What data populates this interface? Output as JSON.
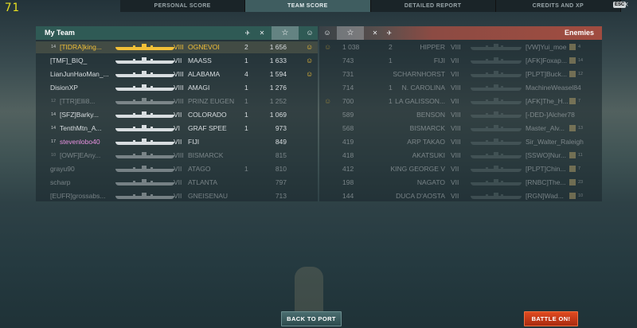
{
  "fps": "71",
  "nav": {
    "tabs": [
      "PERSONAL SCORE",
      "TEAM SCORE",
      "DETAILED REPORT",
      "CREDITS AND XP"
    ],
    "active_index": 1,
    "esc_label": "ESC",
    "close_glyph": "×"
  },
  "my_team": {
    "title": "My Team",
    "header_icons": [
      "plane-icon",
      "crossed-swords-icon",
      "star-icon",
      "achievement-icon"
    ],
    "rows": [
      {
        "level": "14",
        "player": "[TIDRA]king...",
        "tier": "VIII",
        "ship": "OGNEVOI",
        "kills": "2",
        "score": "1 656",
        "ribbon": "☺",
        "highlight": true,
        "player_color": "#f2c038",
        "ship_color": "#f2c038",
        "sil_color": "#f2c038",
        "dead": false
      },
      {
        "level": "",
        "player": "[TMF]_BIQ_",
        "tier": "VII",
        "ship": "MAASS",
        "kills": "1",
        "score": "1 633",
        "ribbon": "☺",
        "highlight": false,
        "player_color": "#d8dde0",
        "ship_color": "#d8dde0",
        "sil_color": "#d8dde0",
        "dead": false
      },
      {
        "level": "",
        "player": "LianJunHaoMan_...",
        "tier": "VIII",
        "ship": "ALABAMA",
        "kills": "4",
        "score": "1 594",
        "ribbon": "☺",
        "highlight": false,
        "player_color": "#d8dde0",
        "ship_color": "#d8dde0",
        "sil_color": "#d8dde0",
        "dead": false
      },
      {
        "level": "",
        "player": "DisionXP",
        "tier": "VIII",
        "ship": "AMAGI",
        "kills": "1",
        "score": "1 276",
        "ribbon": "",
        "highlight": false,
        "player_color": "#d8dde0",
        "ship_color": "#d8dde0",
        "sil_color": "#d8dde0",
        "dead": false
      },
      {
        "level": "12",
        "player": "[TTR]Elli8...",
        "tier": "VIII",
        "ship": "PRINZ EUGEN",
        "kills": "1",
        "score": "1 252",
        "ribbon": "",
        "highlight": false,
        "player_color": "#d8dde0",
        "ship_color": "#d8dde0",
        "sil_color": "#d8dde0",
        "dead": true,
        "rank": "▮"
      },
      {
        "level": "14",
        "player": "[SFZ]Barky...",
        "tier": "VII",
        "ship": "COLORADO",
        "kills": "1",
        "score": "1 069",
        "ribbon": "",
        "highlight": false,
        "player_color": "#d8dde0",
        "ship_color": "#d8dde0",
        "sil_color": "#d8dde0",
        "dead": false
      },
      {
        "level": "14",
        "player": "TenthMtn_A...",
        "tier": "VI",
        "ship": "GRAF SPEE",
        "kills": "1",
        "score": "973",
        "ribbon": "",
        "highlight": false,
        "player_color": "#d8dde0",
        "ship_color": "#d8dde0",
        "sil_color": "#d8dde0",
        "dead": false
      },
      {
        "level": "17",
        "player": "stevenlobo40",
        "tier": "VII",
        "ship": "FIJI",
        "kills": "",
        "score": "849",
        "ribbon": "",
        "highlight": false,
        "player_color": "#e890e0",
        "ship_color": "#d8dde0",
        "sil_color": "#d8dde0",
        "dead": false
      },
      {
        "level": "10",
        "player": "[OWF]EAny...",
        "tier": "VIII",
        "ship": "BISMARCK",
        "kills": "",
        "score": "815",
        "ribbon": "",
        "highlight": false,
        "player_color": "#d8dde0",
        "ship_color": "#d8dde0",
        "sil_color": "#d8dde0",
        "dead": true
      },
      {
        "level": "",
        "player": "grayu90",
        "tier": "VII",
        "ship": "ATAGO",
        "kills": "1",
        "score": "810",
        "ribbon": "",
        "highlight": false,
        "player_color": "#d8dde0",
        "ship_color": "#d8dde0",
        "sil_color": "#d8dde0",
        "dead": true,
        "rank": "▮"
      },
      {
        "level": "",
        "player": "scharp",
        "tier": "VII",
        "ship": "ATLANTA",
        "kills": "",
        "score": "797",
        "ribbon": "",
        "highlight": false,
        "player_color": "#d8dde0",
        "ship_color": "#d8dde0",
        "sil_color": "#d8dde0",
        "dead": true
      },
      {
        "level": "",
        "player": "[EUFR]grossabs...",
        "tier": "VII",
        "ship": "GNEISENAU",
        "kills": "",
        "score": "713",
        "ribbon": "",
        "highlight": false,
        "player_color": "#d8dde0",
        "ship_color": "#d8dde0",
        "sil_color": "#d8dde0",
        "dead": true
      }
    ]
  },
  "enemies": {
    "title": "Enemies",
    "header_icons": [
      "achievement-icon",
      "star-icon",
      "crossed-swords-icon",
      "plane-icon"
    ],
    "rows": [
      {
        "ach": "☺",
        "score": "1 038",
        "kills": "2",
        "ship": "HIPPER",
        "tier": "VIII",
        "player": "[VW]Yui_moe",
        "level": "4",
        "dead": true,
        "rank": ""
      },
      {
        "ach": "",
        "score": "743",
        "kills": "1",
        "ship": "FIJI",
        "tier": "VII",
        "player": "[AFK]Foxap...",
        "level": "14",
        "dead": true,
        "rank": "▮"
      },
      {
        "ach": "",
        "score": "731",
        "kills": "",
        "ship": "SCHARNHORST",
        "tier": "VII",
        "player": "[PLPT]Buck...",
        "level": "12",
        "dead": true,
        "rank": "▮"
      },
      {
        "ach": "",
        "score": "714",
        "kills": "1",
        "ship": "N. CAROLINA",
        "tier": "VIII",
        "player": "MachineWeasel84",
        "level": "",
        "dead": true,
        "rank": ""
      },
      {
        "ach": "☺",
        "score": "700",
        "kills": "1",
        "ship": "LA GALISSON...",
        "tier": "VII",
        "player": "[AFK]The_H...",
        "level": "7",
        "dead": true,
        "rank": "▮"
      },
      {
        "ach": "",
        "score": "589",
        "kills": "",
        "ship": "BENSON",
        "tier": "VIII",
        "player": "[-DED-]Alcher78",
        "level": "",
        "dead": true,
        "rank": ""
      },
      {
        "ach": "",
        "score": "568",
        "kills": "",
        "ship": "BISMARCK",
        "tier": "VIII",
        "player": "Master_Alv...",
        "level": "13",
        "dead": true,
        "rank": ""
      },
      {
        "ach": "",
        "score": "419",
        "kills": "",
        "ship": "ARP TAKAO",
        "tier": "VIII",
        "player": "Sir_Walter_Raleigh",
        "level": "",
        "dead": true,
        "rank": ""
      },
      {
        "ach": "",
        "score": "418",
        "kills": "",
        "ship": "AKATSUKI",
        "tier": "VIII",
        "player": "[SSWO]Nur...",
        "level": "11",
        "dead": true,
        "rank": ""
      },
      {
        "ach": "",
        "score": "412",
        "kills": "",
        "ship": "KING GEORGE V",
        "tier": "VII",
        "player": "[PLPT]Chin...",
        "level": "7",
        "dead": true,
        "rank": "▮"
      },
      {
        "ach": "",
        "score": "198",
        "kills": "",
        "ship": "NAGATO",
        "tier": "VII",
        "player": "[RNBC]The...",
        "level": "23",
        "dead": true,
        "rank": ""
      },
      {
        "ach": "",
        "score": "144",
        "kills": "",
        "ship": "DUCA D'AOSTA",
        "tier": "VII",
        "player": "[RGN]Wad...",
        "level": "10",
        "dead": true,
        "rank": ""
      }
    ]
  },
  "buttons": {
    "back_to_port": "BACK TO PORT",
    "battle_on": "BATTLE ON!"
  }
}
